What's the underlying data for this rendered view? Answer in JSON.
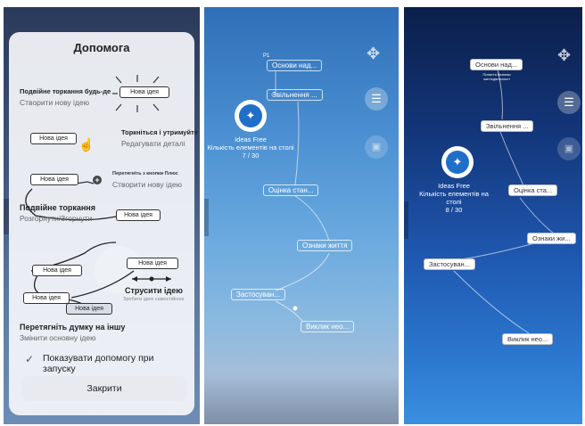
{
  "help": {
    "title": "Допомога",
    "tap_anywhere": "Подвійне торкання будь-де",
    "create_idea": "Створити нову ідею",
    "new_idea": "Нова ідея",
    "touch_hold": "Торкніться і утримуйте",
    "edit_details": "Редагувати деталі",
    "drag_plus": "Перетягніть з кнопки Плюс",
    "create_idea2": "Створити нову ідею",
    "double_tap": "Подвійне торкання",
    "collapse": "Розгорнути/Згорнути",
    "shake_idea": "Струсити ідею",
    "make_independent": "Зробити ідею самостійною",
    "drag_thought": "Перетягніть думку на іншу",
    "change_main": "Змінити основну ідею",
    "show_help_label": "Показувати допомогу при запуску",
    "close_label": "Закрити",
    "checkmark": "✓"
  },
  "screen2": {
    "pin_label": "P1",
    "nodes": [
      "Основи над...",
      "Звільнення ...",
      "Оцінка стан...",
      "Ознаки життя",
      "Застосуван...",
      "Виклик нео..."
    ],
    "app_name": "Ideas Free",
    "count_label": "Кількість елементів на столі",
    "count": "7 / 30"
  },
  "screen3": {
    "nodes": [
      "Основи над...",
      "Звільнення ...",
      "Оцінка ста...",
      "Ознаки жи...",
      "Застосуван...",
      "Виклик нео..."
    ],
    "tiny_note": "Поняття безпеки життєдіяльності",
    "app_name": "Ideas Free",
    "count_label": "Кількість елементів на столі",
    "count": "8 / 30"
  },
  "icons": [
    "menu-icon",
    "move-icon",
    "check-icon",
    "hand-icon",
    "plus-icon",
    "logo-icon"
  ]
}
